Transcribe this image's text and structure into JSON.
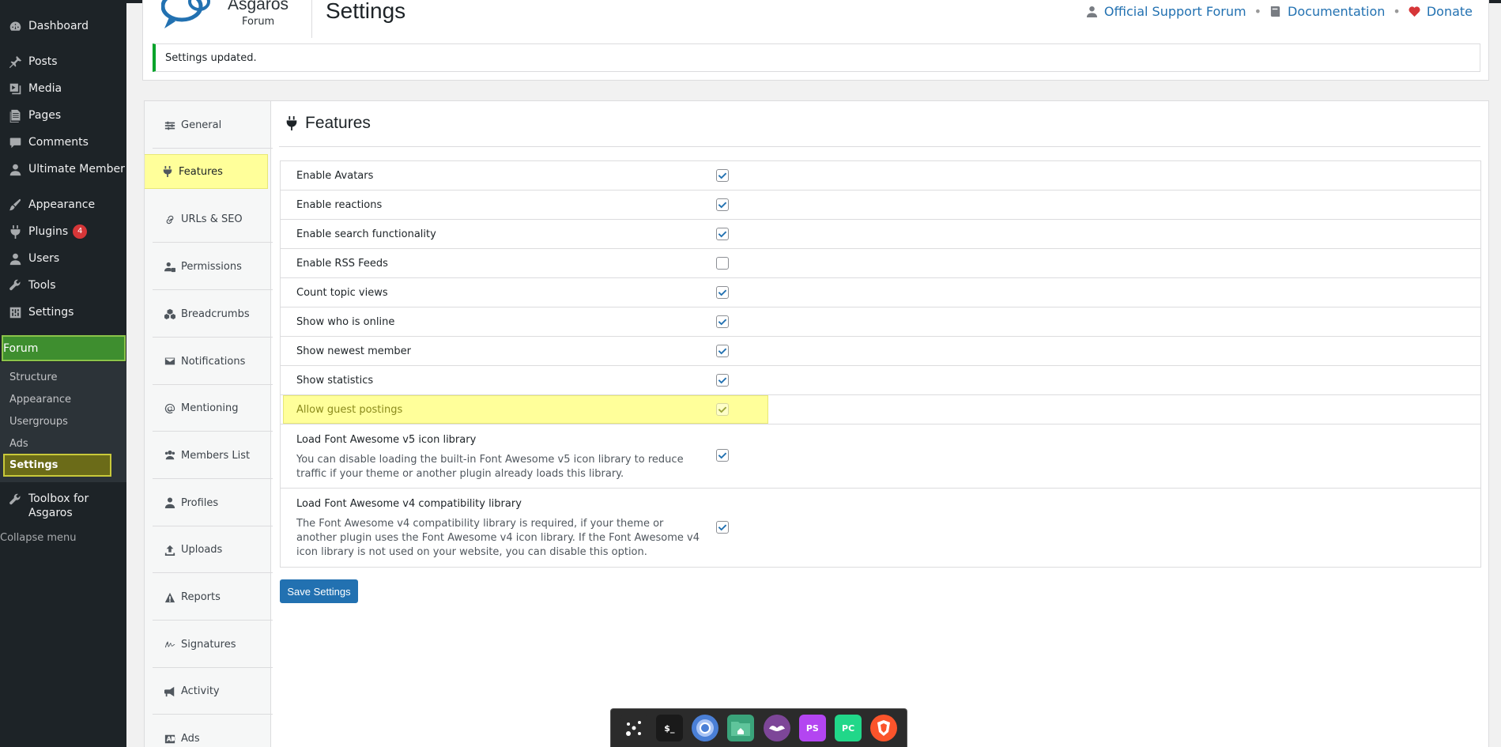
{
  "admin_menu": {
    "items": [
      {
        "label": "Dashboard",
        "icon": "dashboard-icon"
      },
      {
        "label": "Posts",
        "icon": "pin-icon"
      },
      {
        "label": "Media",
        "icon": "media-icon"
      },
      {
        "label": "Pages",
        "icon": "pages-icon"
      },
      {
        "label": "Comments",
        "icon": "comment-icon"
      },
      {
        "label": "Ultimate Member",
        "icon": "user-icon"
      },
      {
        "label": "Appearance",
        "icon": "brush-icon"
      },
      {
        "label": "Plugins",
        "icon": "plug-icon",
        "badge": "4"
      },
      {
        "label": "Users",
        "icon": "users-icon"
      },
      {
        "label": "Tools",
        "icon": "wrench-icon"
      },
      {
        "label": "Settings",
        "icon": "settings-icon"
      }
    ],
    "forum": {
      "label": "Forum",
      "icon": "forum-icon"
    },
    "forum_submenu": [
      "Structure",
      "Appearance",
      "Usergroups",
      "Ads"
    ],
    "forum_active": "Settings",
    "toolbox": {
      "label_line1": "Toolbox for",
      "label_line2": "Asgaros",
      "icon": "wrench-icon"
    },
    "collapse": "Collapse menu"
  },
  "header": {
    "logo_title": "Asgaros",
    "logo_subtitle": "Forum",
    "page_title": "Settings",
    "links": [
      {
        "label": "Official Support Forum",
        "icon": "user-icon",
        "color": "#2271b1"
      },
      {
        "label": "Documentation",
        "icon": "book-icon",
        "color": "#2271b1"
      },
      {
        "label": "Donate",
        "icon": "heart-icon",
        "color": "#d63638"
      }
    ]
  },
  "notice": {
    "text": "Settings updated.",
    "color": "#00a32a"
  },
  "tabs": [
    {
      "label": "General",
      "icon": "sliders-icon"
    },
    {
      "label": "Features",
      "icon": "plug-icon",
      "active": true
    },
    {
      "label": "URLs & SEO",
      "icon": "link-icon"
    },
    {
      "label": "Permissions",
      "icon": "user-lock-icon"
    },
    {
      "label": "Breadcrumbs",
      "icon": "cubes-icon"
    },
    {
      "label": "Notifications",
      "icon": "envelope-icon"
    },
    {
      "label": "Mentioning",
      "icon": "at-icon"
    },
    {
      "label": "Members List",
      "icon": "users-icon"
    },
    {
      "label": "Profiles",
      "icon": "user-icon"
    },
    {
      "label": "Uploads",
      "icon": "upload-icon"
    },
    {
      "label": "Reports",
      "icon": "warning-icon"
    },
    {
      "label": "Signatures",
      "icon": "signature-icon"
    },
    {
      "label": "Activity",
      "icon": "bullhorn-icon"
    },
    {
      "label": "Ads",
      "icon": "ad-icon"
    }
  ],
  "features": {
    "title": "Features",
    "options": [
      {
        "label": "Enable Avatars",
        "checked": true
      },
      {
        "label": "Enable reactions",
        "checked": true
      },
      {
        "label": "Enable search functionality",
        "checked": true
      },
      {
        "label": "Enable RSS Feeds",
        "checked": false
      },
      {
        "label": "Count topic views",
        "checked": true
      },
      {
        "label": "Show who is online",
        "checked": true
      },
      {
        "label": "Show newest member",
        "checked": true
      },
      {
        "label": "Show statistics",
        "checked": true
      },
      {
        "label": "Allow guest postings",
        "checked": true,
        "highlighted": true
      }
    ],
    "long_options": [
      {
        "label": "Load Font Awesome v5 icon library",
        "description": "You can disable loading the built-in Font Awesome v5 icon library to reduce traffic if your theme or another plugin already loads this library.",
        "checked": true
      },
      {
        "label": "Load Font Awesome v4 compatibility library",
        "description": "The Font Awesome v4 compatibility library is required, if your theme or another plugin uses the Font Awesome v4 icon library. If the Font Awesome v4 icon library is not used on your website, you can disable this option.",
        "checked": true
      }
    ],
    "save_label": "Save Settings"
  },
  "dock": {
    "apps": [
      {
        "name": "launcher-icon",
        "color": "#2b2b2b"
      },
      {
        "name": "terminal-icon",
        "color": "#1a1a1a",
        "text": "$_"
      },
      {
        "name": "chromium-icon",
        "color": "#4a7fd6"
      },
      {
        "name": "files-icon",
        "color": "#3aa37a"
      },
      {
        "name": "tor-icon",
        "color": "#7d4698"
      },
      {
        "name": "phpstorm-icon",
        "color": "#b345f1",
        "text": "PS"
      },
      {
        "name": "pycharm-icon",
        "color": "#21d789",
        "text": "PC"
      },
      {
        "name": "brave-icon",
        "color": "#fb542b"
      }
    ]
  }
}
